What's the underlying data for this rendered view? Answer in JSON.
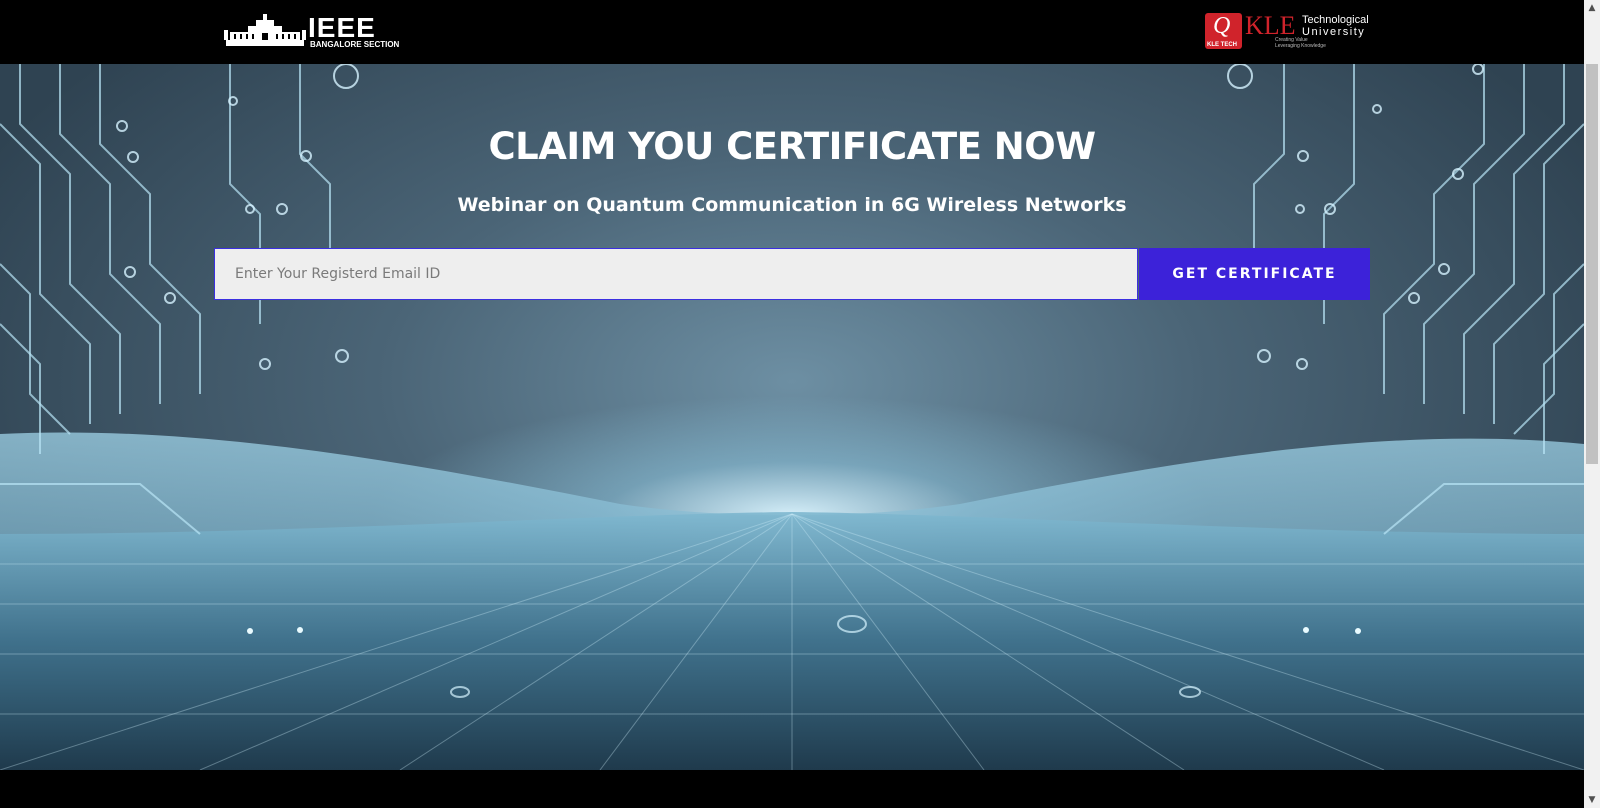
{
  "header": {
    "ieee_logo_word": "IEEE",
    "ieee_logo_sub": "BANGALORE SECTION",
    "kle_logo_mark": "KLE",
    "kle_logo_line1": "Technological",
    "kle_logo_line2": "University",
    "kle_logo_tag": "KLE TECH",
    "kle_logo_tagline1": "Creating Value",
    "kle_logo_tagline2": "Leveraging Knowledge"
  },
  "hero": {
    "title": "CLAIM YOU CERTIFICATE NOW",
    "subtitle": "Webinar on Quantum Communication in 6G Wireless Networks"
  },
  "form": {
    "email_placeholder": "Enter Your Registerd Email ID",
    "email_value": "",
    "submit_label": "GET CERTIFICATE"
  },
  "icons": {
    "scroll_up": "▲",
    "scroll_down": "▼"
  },
  "colors": {
    "button": "#3c22d9",
    "input_border": "#3b2fe0",
    "kle_red": "#d0232b"
  }
}
